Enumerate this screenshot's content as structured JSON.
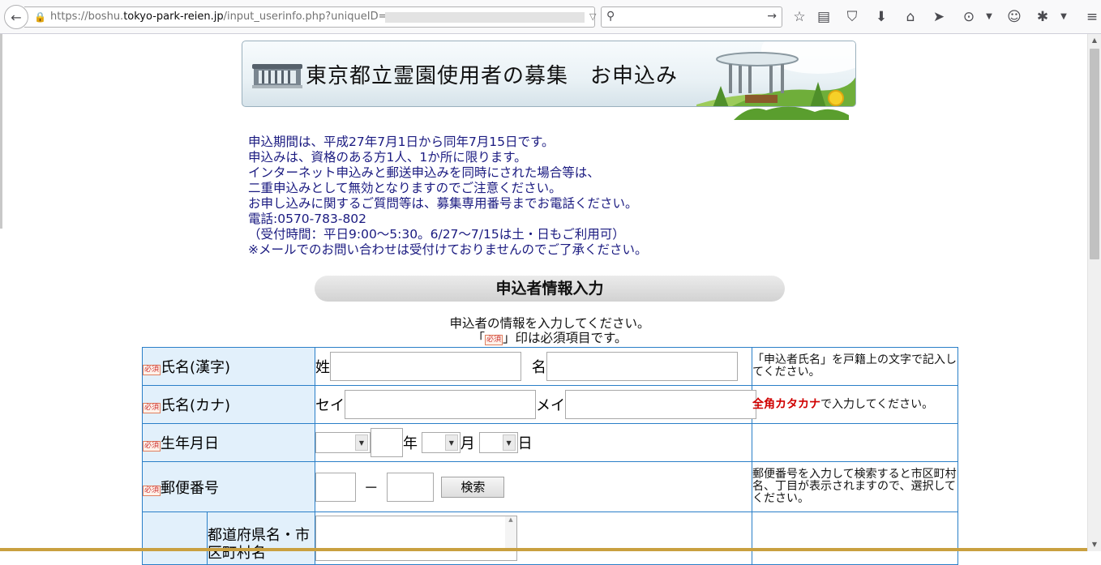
{
  "browser": {
    "url_prefix": "https://boshu.",
    "url_host": "tokyo-park-reien.jp",
    "url_path": "/input_userinfo.php?uniqueID="
  },
  "banner": {
    "title": "東京都立霊園使用者の募集　お申込み"
  },
  "notice": {
    "lines": [
      "申込期間は、平成27年7月1日から同年7月15日です。",
      "申込みは、資格のある方1人、1か所に限ります。",
      "インターネット申込みと郵送申込みを同時にされた場合等は、",
      "二重申込みとして無効となりますのでご注意ください。",
      "お申し込みに関するご質問等は、募集専用番号までお電話ください。",
      "電話:0570-783-802",
      "（受付時間：平日9:00〜5:30。6/27〜7/15は土・日もご利用可）",
      "※メールでのお問い合わせは受付けておりませんのでご了承ください。"
    ]
  },
  "section": {
    "title": "申込者情報入力",
    "instruction_1": "申込者の情報を入力してください。",
    "instruction_2_pre": "「",
    "instruction_2_post": "」印は必須項目です。",
    "required_badge": "必須"
  },
  "form": {
    "name_kanji": {
      "label": "氏名(漢字)",
      "sei_label": "姓",
      "mei_label": "名",
      "sei_value": "",
      "mei_value": "",
      "note": "「申込者氏名」を戸籍上の文字で記入してください。"
    },
    "name_kana": {
      "label": "氏名(カナ)",
      "sei_label": "セイ",
      "mei_label": "メイ",
      "sei_value": "",
      "mei_value": "",
      "note_emph": "全角カタカナ",
      "note_rest": "で入力してください。"
    },
    "birthdate": {
      "label": "生年月日",
      "era_value": "",
      "year_value": "",
      "year_unit": "年",
      "month_value": "",
      "month_unit": "月",
      "day_value": "",
      "day_unit": "日"
    },
    "postal": {
      "label": "郵便番号",
      "part1": "",
      "separator": "－",
      "part2": "",
      "search_button": "検索",
      "note": "郵便番号を入力して検索すると市区町村名、丁目が表示されますので、選択してください。"
    },
    "address": {
      "label": "都道府県名・市区町村名"
    }
  }
}
